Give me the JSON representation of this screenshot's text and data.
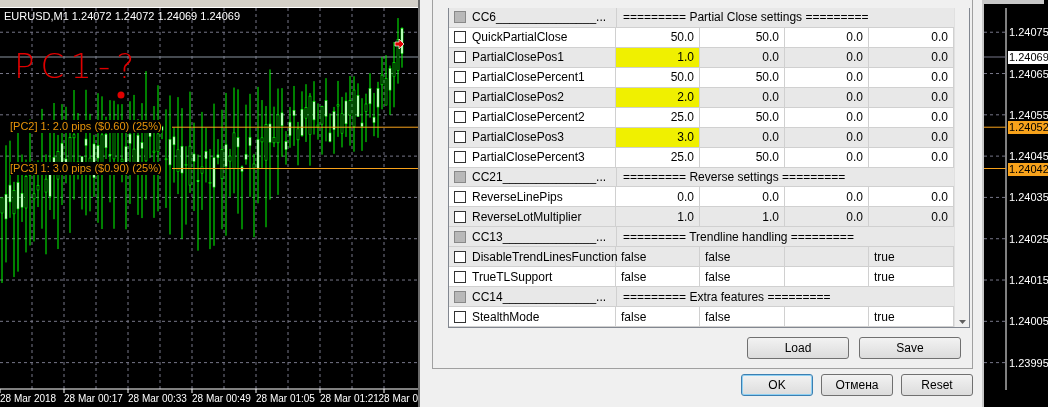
{
  "chart": {
    "symbol_line": "EURUSD,M1  1.24072 1.24072 1.24069 1.24069",
    "annotation": "PC1-?",
    "levels": [
      {
        "label": "[PC2] 1: 2.0 pips ($0.60) (25%)"
      },
      {
        "label": "[PC3] 1: 3.0 pips ($0.90) (25%)"
      }
    ],
    "time_labels": [
      "28 Mar 2018",
      "28 Mar 00:17",
      "28 Mar 00:33",
      "28 Mar 00:49",
      "28 Mar 01:05",
      "28 Mar 01:21",
      "28 Mar 0"
    ],
    "price_labels": [
      {
        "text": "1.24075",
        "kind": "tick"
      },
      {
        "text": "1.24069",
        "kind": "current"
      },
      {
        "text": "1.24065",
        "kind": "tick"
      },
      {
        "text": "1.24055",
        "kind": "tick"
      },
      {
        "text": "1.24052",
        "kind": "level"
      },
      {
        "text": "1.24045",
        "kind": "tick"
      },
      {
        "text": "1.24042",
        "kind": "level"
      },
      {
        "text": "1.24035",
        "kind": "tick"
      },
      {
        "text": "1.24025",
        "kind": "tick"
      },
      {
        "text": "1.24015",
        "kind": "tick"
      },
      {
        "text": "1.24005",
        "kind": "tick"
      },
      {
        "text": "1.23995",
        "kind": "tick"
      }
    ]
  },
  "inputs": {
    "rows": [
      {
        "kind": "group",
        "name": "CC6_______________...",
        "disabled": true,
        "caption": "========= Partial Close settings ========="
      },
      {
        "kind": "number",
        "name": "QuickPartialClose",
        "checked": false,
        "highlighted": false,
        "value": "50.0",
        "start": "50.0",
        "step": "0.0",
        "stop": "0.0"
      },
      {
        "kind": "number",
        "name": "PartialClosePos1",
        "checked": false,
        "highlighted": true,
        "value": "1.0",
        "start": "0.0",
        "step": "0.0",
        "stop": "0.0"
      },
      {
        "kind": "number",
        "name": "PartialClosePercent1",
        "checked": false,
        "highlighted": false,
        "value": "50.0",
        "start": "50.0",
        "step": "0.0",
        "stop": "0.0"
      },
      {
        "kind": "number",
        "name": "PartialClosePos2",
        "checked": false,
        "highlighted": true,
        "value": "2.0",
        "start": "0.0",
        "step": "0.0",
        "stop": "0.0"
      },
      {
        "kind": "number",
        "name": "PartialClosePercent2",
        "checked": false,
        "highlighted": false,
        "value": "25.0",
        "start": "50.0",
        "step": "0.0",
        "stop": "0.0"
      },
      {
        "kind": "number",
        "name": "PartialClosePos3",
        "checked": false,
        "highlighted": true,
        "value": "3.0",
        "start": "0.0",
        "step": "0.0",
        "stop": "0.0"
      },
      {
        "kind": "number",
        "name": "PartialClosePercent3",
        "checked": false,
        "highlighted": false,
        "value": "25.0",
        "start": "50.0",
        "step": "0.0",
        "stop": "0.0"
      },
      {
        "kind": "group",
        "name": "CC21______________...",
        "disabled": true,
        "caption": "========= Reverse settings ========="
      },
      {
        "kind": "number",
        "name": "ReverseLinePips",
        "checked": false,
        "highlighted": false,
        "value": "0.0",
        "start": "0.0",
        "step": "0.0",
        "stop": "0.0"
      },
      {
        "kind": "number",
        "name": "ReverseLotMultiplier",
        "checked": false,
        "highlighted": false,
        "value": "1.0",
        "start": "1.0",
        "step": "0.0",
        "stop": "0.0"
      },
      {
        "kind": "group",
        "name": "CC13______________...",
        "disabled": true,
        "caption": "========= Trendline handling ========="
      },
      {
        "kind": "bool",
        "name": "DisableTrendLinesFunction",
        "checked": false,
        "highlighted": false,
        "value": "false",
        "start": "false",
        "stop": "true"
      },
      {
        "kind": "bool",
        "name": "TrueTLSupport",
        "checked": false,
        "highlighted": false,
        "value": "false",
        "start": "false",
        "stop": "true"
      },
      {
        "kind": "group",
        "name": "CC14______________...",
        "disabled": true,
        "caption": "========= Extra features ========="
      },
      {
        "kind": "bool",
        "name": "StealthMode",
        "checked": false,
        "highlighted": false,
        "value": "false",
        "start": "false",
        "stop": "true"
      }
    ]
  },
  "file_buttons": [
    "Load",
    "Save"
  ],
  "dialog_buttons": [
    {
      "label": "OK",
      "default": true
    },
    {
      "label": "Отмена",
      "default": false
    },
    {
      "label": "Reset",
      "default": false
    }
  ]
}
